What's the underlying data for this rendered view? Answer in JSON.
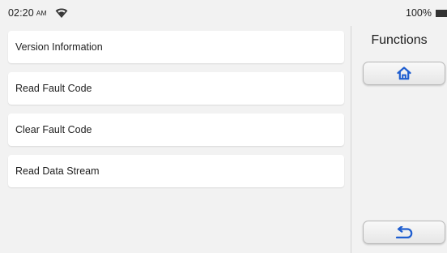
{
  "status": {
    "time": "02:20",
    "ampm": "AM",
    "battery": "100%"
  },
  "menu": {
    "items": [
      {
        "label": "Version Information"
      },
      {
        "label": "Read Fault Code"
      },
      {
        "label": "Clear Fault Code"
      },
      {
        "label": "Read Data Stream"
      }
    ]
  },
  "panel": {
    "title": "Functions",
    "home_icon": "home-icon",
    "back_icon": "back-arrow-icon"
  },
  "colors": {
    "background": "#f2f2f2",
    "item_background": "#ffffff",
    "icon_blue": "#1f5ed0"
  }
}
